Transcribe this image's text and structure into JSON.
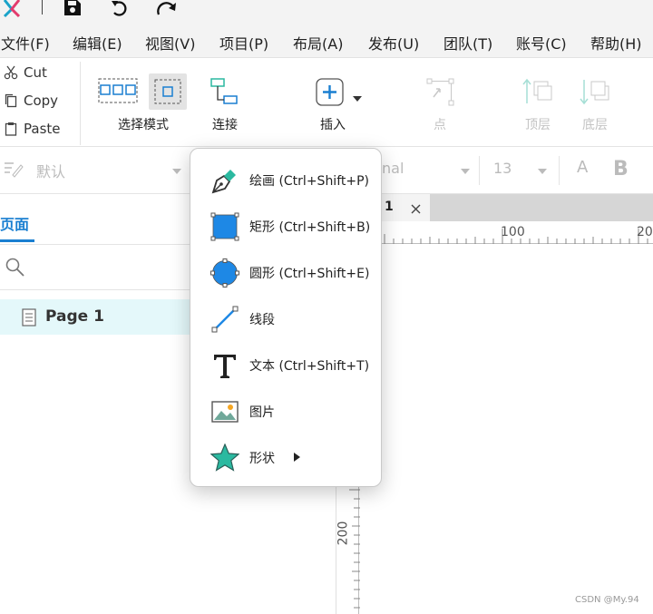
{
  "menu": {
    "items": [
      "文件(F)",
      "编辑(E)",
      "视图(V)",
      "项目(P)",
      "布局(A)",
      "发布(U)",
      "团队(T)",
      "账号(C)",
      "帮助(H)"
    ]
  },
  "clipboard": {
    "cut": "Cut",
    "copy": "Copy",
    "paste": "Paste"
  },
  "toolbar": {
    "select_mode": "选择模式",
    "connect": "连接",
    "insert": "插入",
    "point": "点",
    "top_layer": "顶层",
    "bottom_layer": "底层"
  },
  "format": {
    "style_value": "默认",
    "font_value": "nal",
    "size_value": "13",
    "font_color_letter": "A",
    "bold_letter": "B"
  },
  "left_panel": {
    "tab_pages": "页面",
    "pages": [
      "Page 1"
    ]
  },
  "canvas": {
    "tab_label": "1",
    "ruler_h": [
      "100",
      "20"
    ],
    "ruler_v": [
      "200"
    ]
  },
  "insert_menu": {
    "items": [
      {
        "icon": "pen-icon",
        "label": "绘画 (Ctrl+Shift+P)"
      },
      {
        "icon": "rectangle-icon",
        "label": "矩形 (Ctrl+Shift+B)"
      },
      {
        "icon": "circle-icon",
        "label": "圆形 (Ctrl+Shift+E)"
      },
      {
        "icon": "line-icon",
        "label": "线段"
      },
      {
        "icon": "text-icon",
        "label": "文本 (Ctrl+Shift+T)"
      },
      {
        "icon": "image-icon",
        "label": "图片"
      },
      {
        "icon": "star-icon",
        "label": "形状"
      }
    ]
  },
  "watermark": "CSDN @My.94",
  "colors": {
    "accent": "#1a7fd1",
    "shape_fill": "#1e88e5",
    "teal": "#2bb9a0"
  }
}
